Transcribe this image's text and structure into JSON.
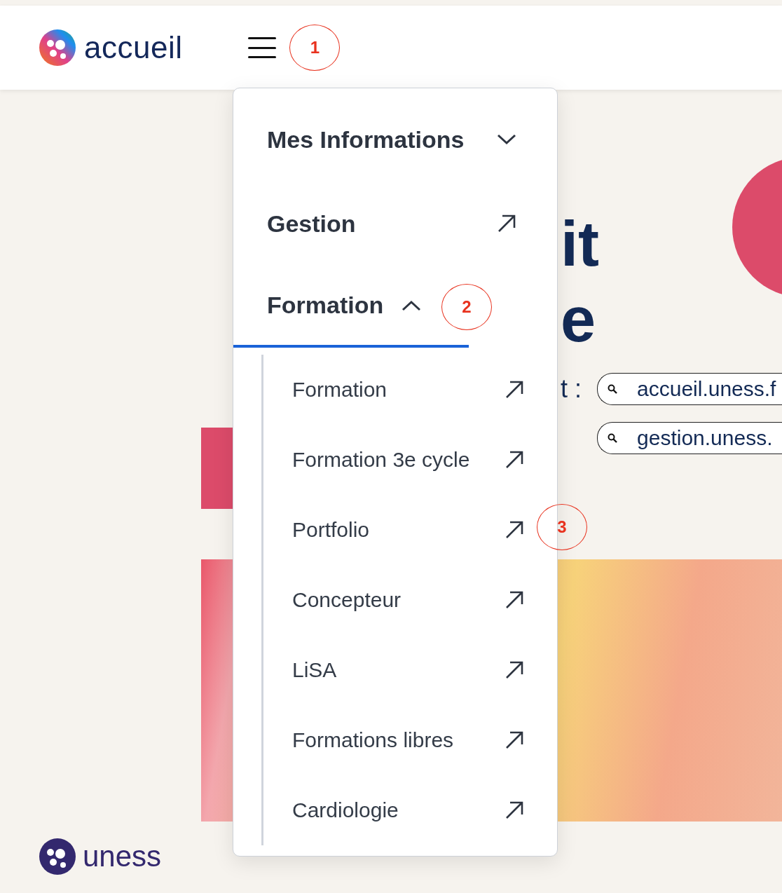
{
  "header": {
    "logo_text": "accueil",
    "callout": "1"
  },
  "hero": {
    "title_lines": [
      "it",
      "e"
    ],
    "search_label": "t :",
    "search_pills": [
      "accueil.uness.f",
      "gestion.uness."
    ]
  },
  "menu": {
    "items": [
      {
        "label": "Mes Informations",
        "kind": "dropdown",
        "expanded": false,
        "selected": false
      },
      {
        "label": "Gestion",
        "kind": "link",
        "selected": false
      },
      {
        "label": "Formation",
        "kind": "dropdown",
        "expanded": true,
        "selected": true,
        "callout": "2",
        "children": [
          {
            "label": "Formation"
          },
          {
            "label": "Formation 3e cycle"
          },
          {
            "label": "Portfolio",
            "callout": "3"
          },
          {
            "label": "Concepteur"
          },
          {
            "label": "LiSA"
          },
          {
            "label": "Formations libres"
          },
          {
            "label": "Cardiologie"
          }
        ]
      }
    ]
  },
  "footer": {
    "logo_text": "uness"
  }
}
